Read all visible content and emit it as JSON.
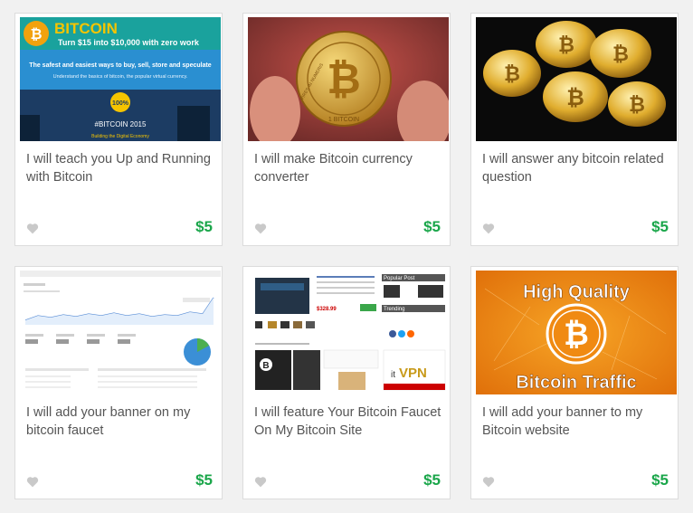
{
  "colors": {
    "price": "#1aa64a",
    "heart": "#c9c9c9",
    "title": "#555555"
  },
  "gigs": [
    {
      "title": "I will teach you Up and Running with Bitcoin",
      "price": "$5",
      "thumb": {
        "brand": "BITCOIN",
        "tagline": "Turn $15 into $10,000 with zero work",
        "line1": "The safest and easiest ways to buy, sell, store and speculate",
        "line2": "Understand the basics of bitcoin, the popular virtual currency.",
        "badge": "100%",
        "hashtag": "#BITCOIN 2015",
        "footer": "Building the Digital Economy"
      }
    },
    {
      "title": "I will make Bitcoin currency converter",
      "price": "$5",
      "thumb": {
        "coin_text": "1 BITCOIN",
        "coin_left": "VIRES IN NUMERIS"
      }
    },
    {
      "title": "I will answer any bitcoin related question",
      "price": "$5",
      "thumb": {}
    },
    {
      "title": "I will add your banner on my bitcoin faucet",
      "price": "$5",
      "thumb": {}
    },
    {
      "title": "I will feature Your Bitcoin Faucet On My Bitcoin Site",
      "price": "$5",
      "thumb": {
        "popular": "Popular Post",
        "trending": "Trending",
        "price_tag": "$328.99",
        "vpn": "VPN",
        "vpn_prefix": "it"
      }
    },
    {
      "title": "I will add your banner to my Bitcoin website",
      "price": "$5",
      "thumb": {
        "top": "High Quality",
        "bottom": "Bitcoin Traffic"
      }
    }
  ]
}
